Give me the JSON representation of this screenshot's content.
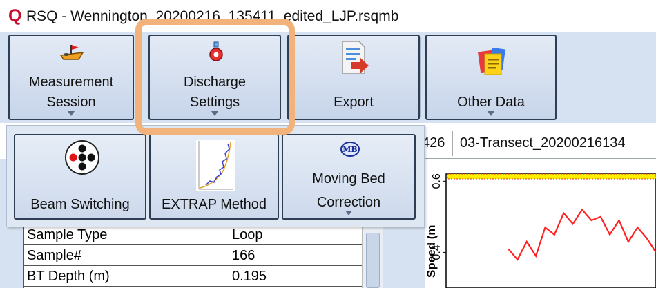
{
  "window": {
    "logo": "Q",
    "title": "RSQ - Wennington_20200216_135411_edited_LJP.rsqmb"
  },
  "ribbon": {
    "buttons": [
      {
        "label_line1": "Measurement",
        "label_line2": "Session",
        "icon": "boat-icon"
      },
      {
        "label_line1": "Discharge",
        "label_line2": "Settings",
        "icon": "flask-gear-icon"
      },
      {
        "label_line1": "",
        "label_line2": "Export",
        "icon": "export-document-icon"
      },
      {
        "label_line1": "",
        "label_line2": "Other Data",
        "icon": "documents-icon"
      }
    ]
  },
  "dropdown": {
    "items": [
      {
        "label": "Beam Switching",
        "icon": "beam-pattern-icon"
      },
      {
        "label": "EXTRAP Method",
        "icon": "profile-plot-icon"
      },
      {
        "label_line1": "Moving Bed",
        "label_line2": "Correction",
        "icon": "mb-badge-icon",
        "badge": "MB"
      }
    ]
  },
  "tabs": [
    {
      "label": "426"
    },
    {
      "label": "03-Transect_20200216134"
    }
  ],
  "properties": {
    "rows": [
      {
        "name": "Sample Type",
        "value": "Loop"
      },
      {
        "name": "Sample#",
        "value": "166"
      },
      {
        "name": "BT Depth (m)",
        "value": "0.195"
      }
    ]
  },
  "chart_data": {
    "type": "line",
    "ylabel": "Speed (m",
    "y_ticks": [
      "0.6",
      "0.4"
    ],
    "ylim": [
      0.3,
      0.62
    ],
    "series": [
      {
        "color": "#ff2020",
        "values": [
          0.41,
          0.38,
          0.43,
          0.39,
          0.47,
          0.45,
          0.51,
          0.48,
          0.52,
          0.49,
          0.5,
          0.45,
          0.49,
          0.43,
          0.47,
          0.44,
          0.4
        ]
      }
    ],
    "marker_band_color": "#ffee00"
  },
  "colors": {
    "accent_highlight": "#f2b27c",
    "ribbon_bg": "#d6e2f1",
    "button_border": "#2e3f55"
  }
}
